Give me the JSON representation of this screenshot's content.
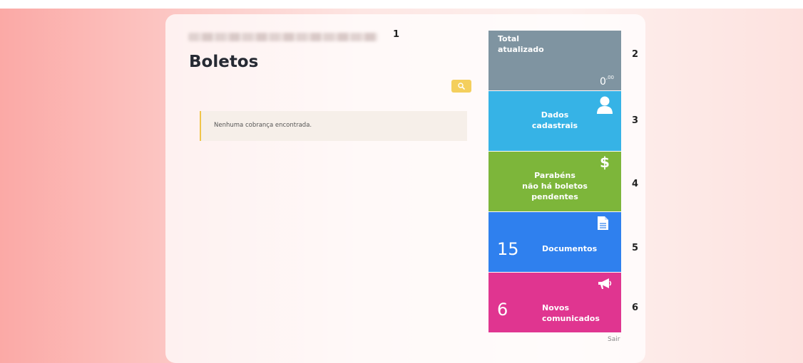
{
  "page": {
    "title": "Boletos",
    "empty_message": "Nenhuma cobrança encontrada."
  },
  "annotations": [
    "1",
    "2",
    "3",
    "4",
    "5",
    "6"
  ],
  "tiles": {
    "total": {
      "label_line1": "Total",
      "label_line2": "atualizado",
      "value": "0",
      "cents": ",00",
      "color": "#7f94a1"
    },
    "dados": {
      "label_line1": "Dados",
      "label_line2": "cadastrais",
      "icon": "user-icon",
      "color": "#36b3e6"
    },
    "boletos": {
      "label_line1": "Parabéns",
      "label_line2": "não há boletos",
      "label_line3": "pendentes",
      "icon": "dollar-icon",
      "color": "#7db63a"
    },
    "documentos": {
      "count": "15",
      "label": "Documentos",
      "icon": "document-icon",
      "color": "#2f80ee"
    },
    "comunicados": {
      "count": "6",
      "label_line1": "Novos",
      "label_line2": "comunicados",
      "icon": "megaphone-icon",
      "color": "#e03590"
    }
  },
  "footer": {
    "logout": "Sair"
  },
  "colors": {
    "search_button": "#f4cf5d",
    "notice_border": "#f0c54a"
  }
}
